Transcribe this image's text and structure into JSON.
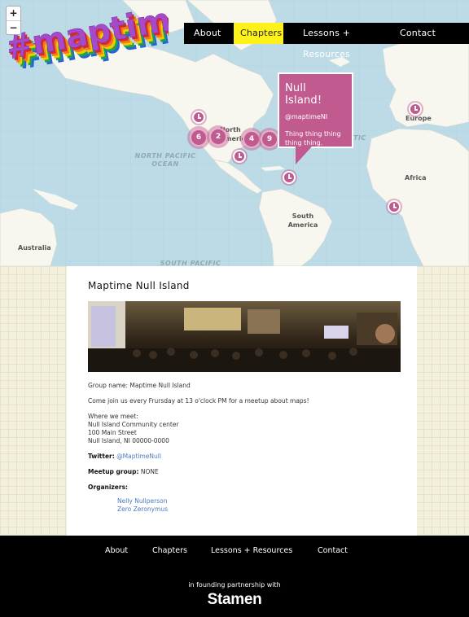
{
  "logo": {
    "text": "#maptime!"
  },
  "zoom": {
    "in": "+",
    "out": "−"
  },
  "nav": [
    {
      "label": "About",
      "active": false
    },
    {
      "label": "Chapters",
      "active": true
    },
    {
      "label": "Lessons + Resources",
      "active": false
    },
    {
      "label": "Contact",
      "active": false
    }
  ],
  "map_labels": {
    "north_america": "North America",
    "north_pacific": "NORTH PACIFIC OCEAN",
    "south_america": "South America",
    "europe": "Europe",
    "africa": "Africa",
    "australia": "Australia",
    "south_pacific": "SOUTH PACIFIC",
    "atlantic_fragment": "TIC"
  },
  "clusters": [
    "6",
    "2",
    "4",
    "9"
  ],
  "popup": {
    "title": "Null Island!",
    "handle": "@maptimeNI",
    "description": "Thing thing thing thing thing."
  },
  "chapter": {
    "title": "Maptime Null Island",
    "group_name": "Group name: Maptime Null Island",
    "description": "Come join us every Frursday at 13 o'clock PM for a meetup about maps!",
    "where_label": "Where we meet:",
    "where_line1": "Null Island Community center",
    "where_line2": "100 Main Street",
    "where_line3": "Null Island, NI 00000-0000",
    "twitter_label": "Twitter:",
    "twitter_handle": "@MaptimeNull",
    "meetup_label": "Meetup group:",
    "meetup_value": "NONE",
    "organizers_label": "Organizers:",
    "organizers": [
      "Nelly Nullperson",
      "Zero Zeronymus"
    ]
  },
  "footer": {
    "nav": [
      "About",
      "Chapters",
      "Lessons + Resources",
      "Contact"
    ],
    "partner_text": "in founding partnership with",
    "partner_name": "Stamen"
  },
  "colors": {
    "accent_pink": "#c15a8f",
    "nav_active": "#fff21a",
    "link": "#4a7bbd",
    "water": "#bcdbe6",
    "land": "#f7f6ef"
  }
}
